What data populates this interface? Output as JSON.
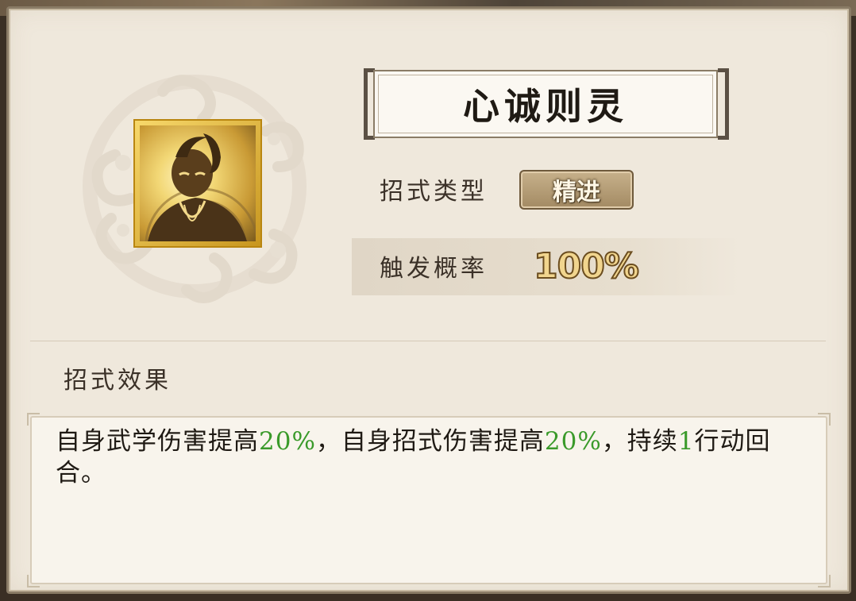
{
  "colors": {
    "panel_bg": "#efe8dc",
    "highlight_green": "#3a9a2a",
    "badge_brown": "#a38a63",
    "portrait_gold": "#f7d86b"
  },
  "skill": {
    "title": "心诚则灵",
    "portrait_icon": "monk-portrait-icon"
  },
  "info": {
    "type_label": "招式类型",
    "type_value": "精进",
    "prob_label": "触发概率",
    "prob_value": "100%"
  },
  "effect": {
    "title": "招式效果",
    "segments": [
      {
        "text": "自身武学伤害提高",
        "highlight": false
      },
      {
        "text": "20%",
        "highlight": true
      },
      {
        "text": "，自身招式伤害提高",
        "highlight": false
      },
      {
        "text": "20%",
        "highlight": true
      },
      {
        "text": "，持续",
        "highlight": false
      },
      {
        "text": "1",
        "highlight": true
      },
      {
        "text": "行动回合。",
        "highlight": false
      }
    ]
  }
}
